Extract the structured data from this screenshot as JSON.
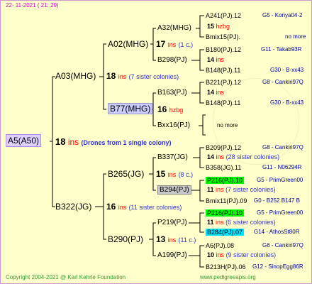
{
  "date": "22- 11-2021 ( 21: 29)",
  "footer": {
    "copyright": "Copyright 2004-2021 @ Karl Kehrle Foundation",
    "url": "www.pedigreeapis.org"
  },
  "root": {
    "label": "A5(A50)",
    "num": "18",
    "ins": "ins",
    "note": "(Drones from 1 single colony)"
  },
  "g1": [
    {
      "label": "A03(MHG)",
      "num": "18",
      "ins": "ins",
      "note": "(7 sister colonies)"
    },
    {
      "label": "B322(JG)",
      "num": "16",
      "ins": "ins",
      "note": "(11 sister colonies)"
    }
  ],
  "g2": [
    {
      "label": "A02(MHG)",
      "num": "17",
      "ins": "ins",
      "note": "(1 c.)"
    },
    {
      "label": "B77(MHG)",
      "num": "16",
      "ins": "hzbg",
      "note": ""
    },
    {
      "label": "B265(JG)",
      "num": "15",
      "ins": "ins",
      "note": "(8 c.)"
    },
    {
      "label": "B290(PJ)",
      "num": "13",
      "ins": "ins",
      "note": "(11 c.)"
    }
  ],
  "g3": [
    {
      "label": "A32(MHG)",
      "num": "15",
      "ins": "hzbg"
    },
    {
      "label": "B298(PJ)",
      "num": "",
      "ins": ""
    },
    {
      "label": "B163(PJ)",
      "num": "",
      "ins": ""
    },
    {
      "label": "Bxx16(PJ)",
      "num": "",
      "ins": ""
    },
    {
      "label": "B337(JG)",
      "num": "14",
      "ins": "ins",
      "note": "(28 sister colonies)"
    },
    {
      "label": "B294(PJ)",
      "num": "",
      "ins": ""
    },
    {
      "label": "P219(PJ)",
      "num": "11",
      "ins": "ins",
      "note": "(6 sister colonies)"
    },
    {
      "label": "A199(PJ)",
      "num": "10",
      "ins": "ins",
      "note": "(9 sister colonies)"
    }
  ],
  "g4": [
    {
      "label": "A241(PJ).12",
      "ref": "G5 - Konya04-2"
    },
    {
      "label": "Bmix15(PJ).",
      "ref": "no more"
    },
    {
      "label": "B180(PJ).12",
      "ref": "G11 - Takab93R"
    },
    {
      "label": "B148(PJ).11",
      "ref": "G30 - B-xx43"
    },
    {
      "label": "B221(PJ).12",
      "ref": "G8 - Cankiri97Q"
    },
    {
      "label": "B148(PJ).11",
      "ref": "G30 - B-xx43"
    },
    {
      "label": "no more",
      "ref": ""
    },
    {
      "label": "B209(PJ).12",
      "ref": "G8 - Cankiri97Q"
    },
    {
      "label": "B358(JG).11",
      "ref": "G11 - N06294R"
    },
    {
      "label": "P216(PJ).10",
      "ref": "G5 - PrimGreen00"
    },
    {
      "label": "Bmix11(PJ).09",
      "ref": "G0 - B252 B147 B"
    },
    {
      "label": "P216(PJ).10",
      "ref": "G5 - PrimGreen00"
    },
    {
      "label": "B284(PJ).07",
      "ref": "G14 - AthosSt80R"
    },
    {
      "label": "A6(PJ).08",
      "ref": "G6 - Cankiri97Q"
    },
    {
      "label": "B213H(PJ).06",
      "ref": "G12 - SinopEgg86R"
    }
  ],
  "g4mid": [
    {
      "num": "15",
      "ins": "hzbg"
    },
    {
      "num": "14",
      "ins": "ins"
    },
    {
      "num": "14",
      "ins": "ins"
    },
    {
      "num": "14",
      "ins": "ins",
      "note": "(28 sister colonies)"
    },
    {
      "num": "11",
      "ins": "ins",
      "note": "(7 sister colonies)"
    },
    {
      "num": "11",
      "ins": "ins",
      "note": "(6 sister colonies)"
    },
    {
      "num": "10",
      "ins": "ins",
      "note": "(9 sister colonies)"
    }
  ]
}
